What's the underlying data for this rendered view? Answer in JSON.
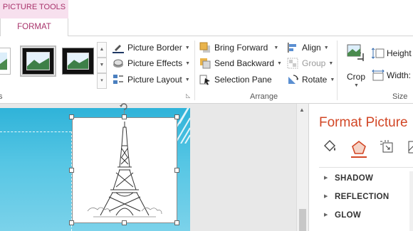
{
  "ribbon": {
    "contextual_group": "PICTURE TOOLS",
    "active_tab": "FORMAT",
    "picture_styles": {
      "border_label": "Picture Border",
      "effects_label": "Picture Effects",
      "layout_label": "Picture Layout"
    },
    "arrange": {
      "group_label": "Arrange",
      "bring_forward": "Bring Forward",
      "send_backward": "Send Backward",
      "selection_pane": "Selection Pane",
      "align": "Align",
      "group": "Group",
      "rotate": "Rotate"
    },
    "size": {
      "group_label": "Size",
      "crop": "Crop",
      "height_label": "Height",
      "width_label": "Width:"
    }
  },
  "format_pane": {
    "title": "Format Picture",
    "sections": [
      "SHADOW",
      "REFLECTION",
      "GLOW"
    ]
  },
  "colors": {
    "accent_pink": "#a8336b",
    "pane_title": "#d24726",
    "slide_blue": "#2fb3d9"
  }
}
